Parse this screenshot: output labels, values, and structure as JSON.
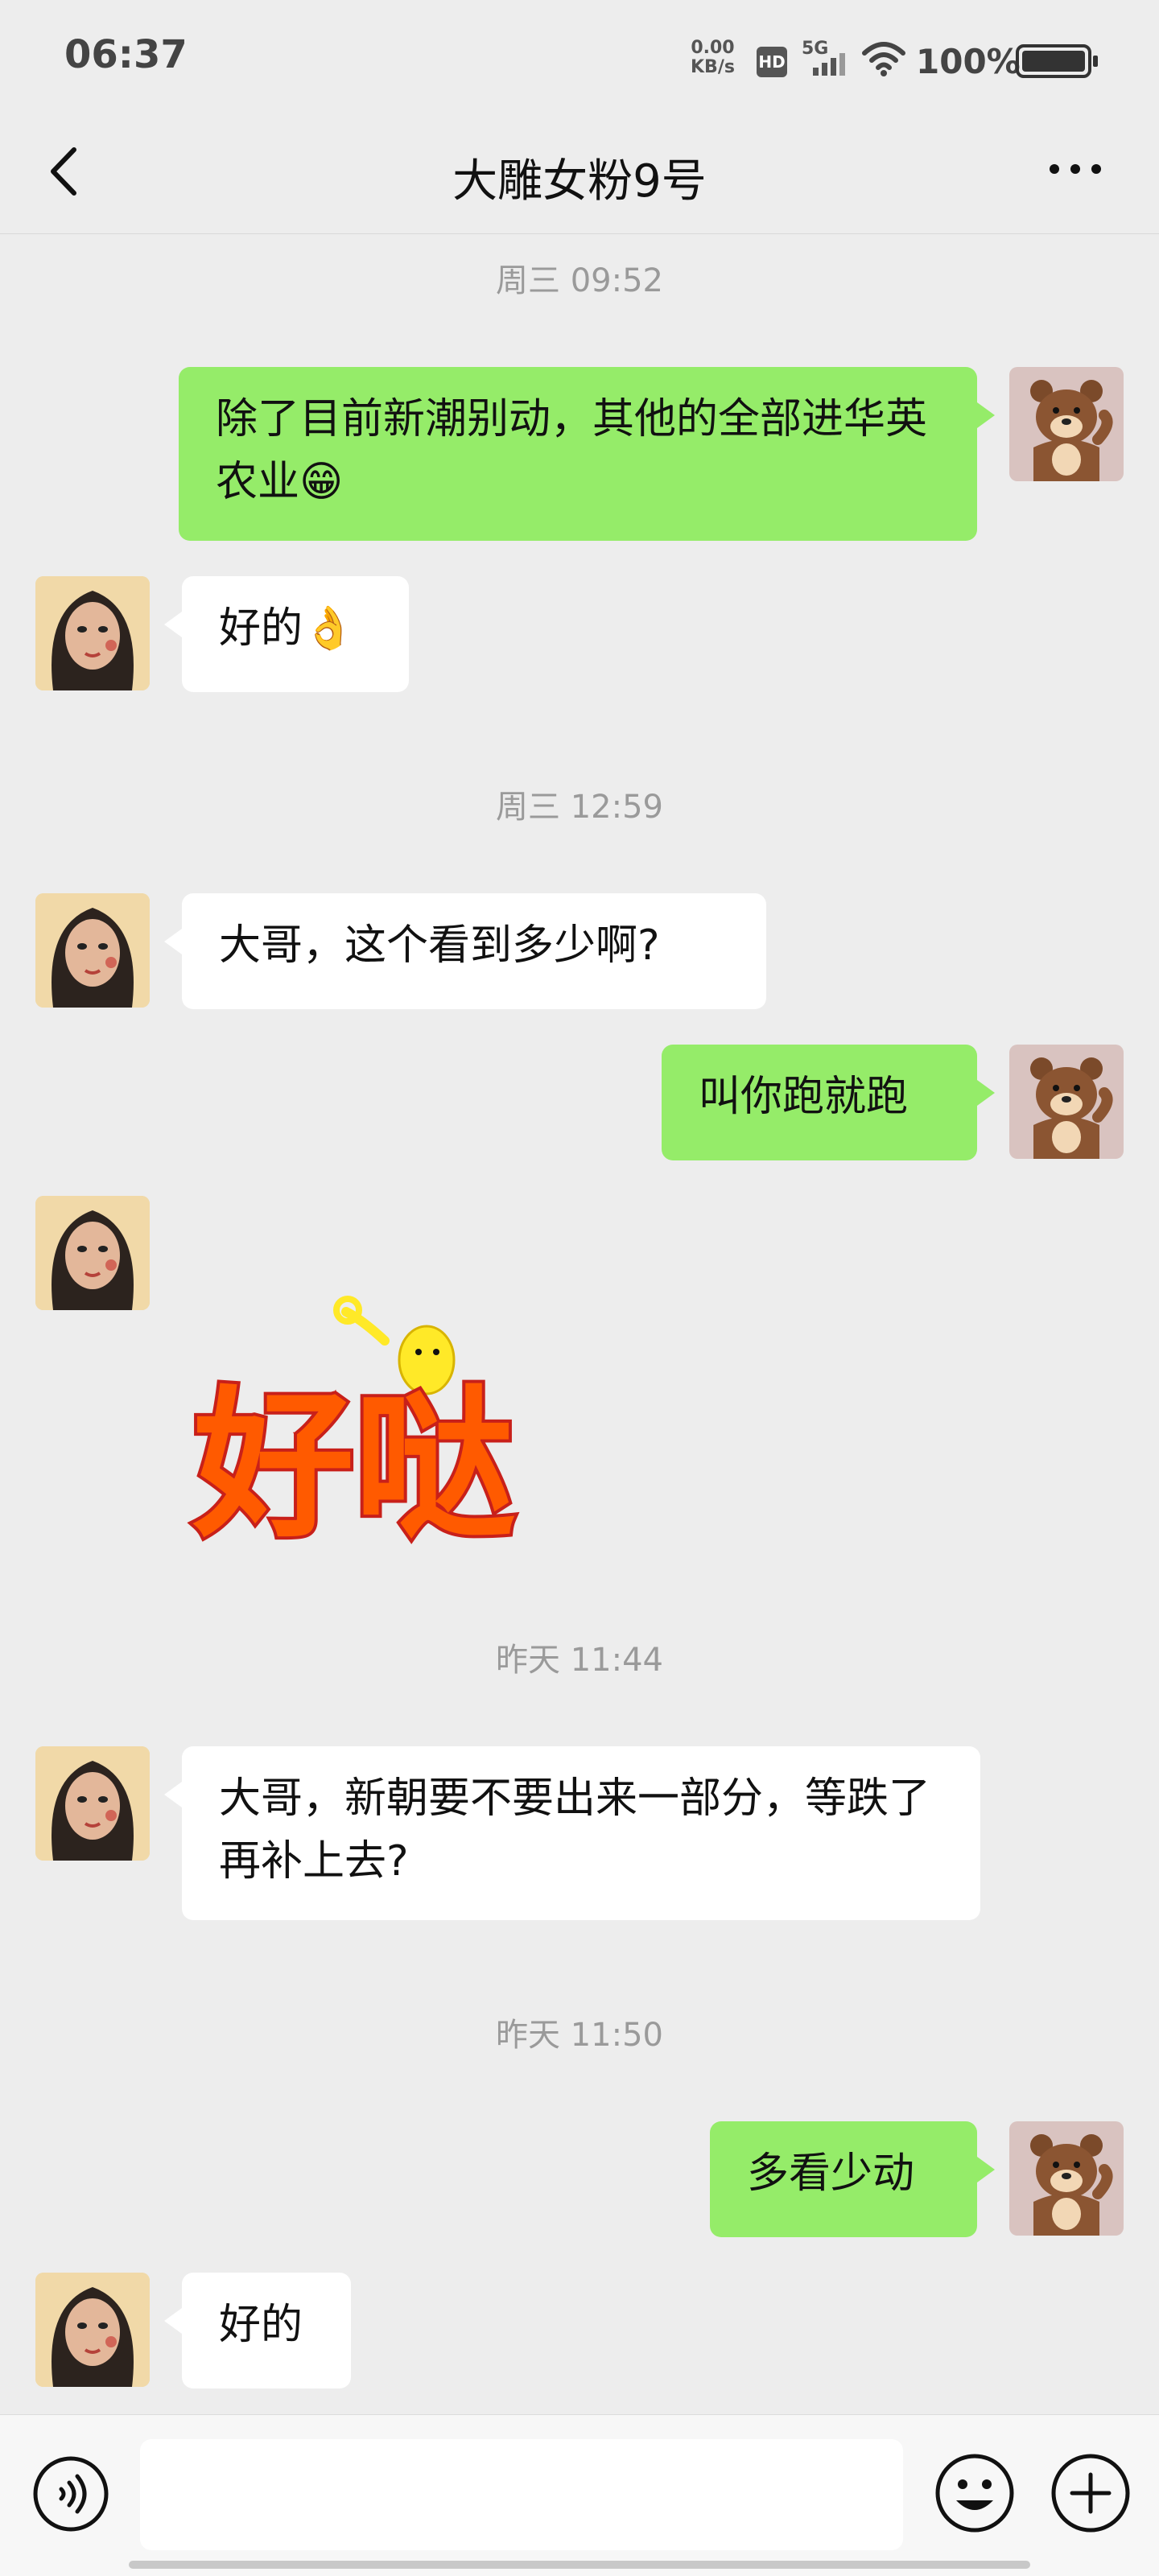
{
  "status_bar": {
    "time": "06:37",
    "net_speed_value": "0.00",
    "net_speed_unit": "KB/s",
    "hd_label": "HD",
    "signal_label": "5G",
    "battery_percent": "100%"
  },
  "header": {
    "title": "大雕女粉9号"
  },
  "messages": [
    {
      "type": "timestamp",
      "text": "周三 09:52"
    },
    {
      "type": "text",
      "sender": "me",
      "text": "除了目前新潮别动，其他的全部进华英农业😁"
    },
    {
      "type": "text",
      "sender": "her",
      "text": "好的👌"
    },
    {
      "type": "timestamp",
      "text": "周三 12:59"
    },
    {
      "type": "text",
      "sender": "her",
      "text": "大哥，这个看到多少啊?"
    },
    {
      "type": "text",
      "sender": "me",
      "text": "叫你跑就跑"
    },
    {
      "type": "sticker",
      "sender": "her",
      "text": "好哒"
    },
    {
      "type": "timestamp",
      "text": "昨天 11:44"
    },
    {
      "type": "text",
      "sender": "her",
      "text": "大哥，新朝要不要出来一部分，等跌了再补上去?"
    },
    {
      "type": "timestamp",
      "text": "昨天 11:50"
    },
    {
      "type": "text",
      "sender": "me",
      "text": "多看少动"
    },
    {
      "type": "text",
      "sender": "her",
      "text": "好的"
    }
  ],
  "input_bar": {
    "placeholder": ""
  },
  "colors": {
    "background": "#ededed",
    "my_bubble": "#95ec69",
    "her_bubble": "#ffffff",
    "sticker_fill": "#ff5a00",
    "sticker_outline": "#c8201a"
  },
  "icons": [
    "back-arrow-icon",
    "more-dots-icon",
    "voice-icon",
    "emoji-icon",
    "plus-icon",
    "wifi-icon",
    "battery-icon"
  ]
}
